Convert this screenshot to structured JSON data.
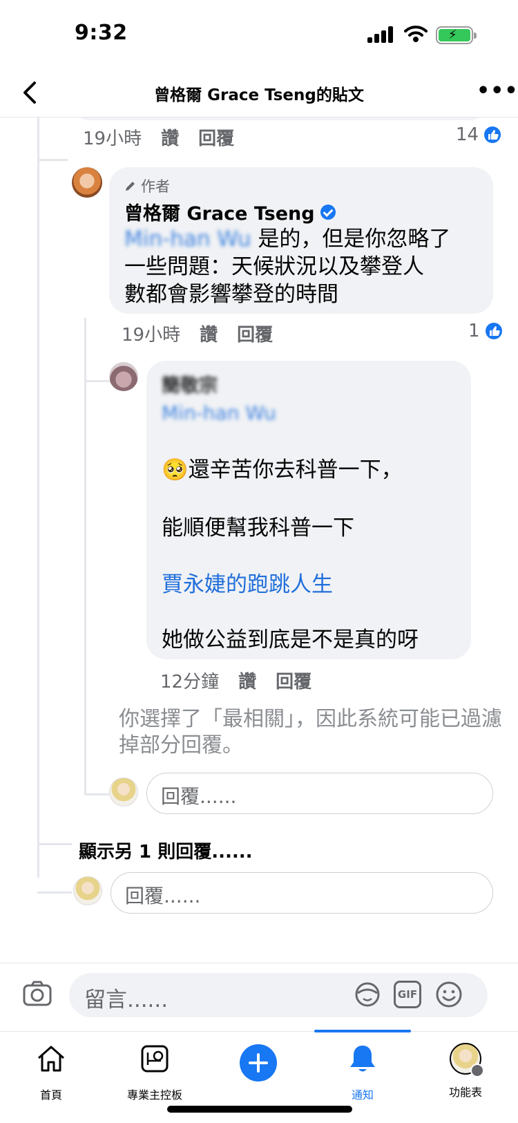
{
  "status": {
    "time": "9:32"
  },
  "header": {
    "title": "曾格爾 Grace Tseng的貼文"
  },
  "thread": {
    "top_comment_meta": {
      "time": "19小時",
      "like": "讚",
      "reply": "回覆",
      "reactions": "14"
    },
    "author_reply": {
      "tag": "作者",
      "name": "曾格爾 Grace Tseng",
      "mention": "Min-han Wu",
      "text_line1": "是的，但是你忽略了",
      "text_line2": "一些問題：天候狀況以及攀登人",
      "text_line3": "數都會影響攀登的時間",
      "time": "19小時",
      "like": "讚",
      "reply": "回覆",
      "reactions": "1"
    },
    "nested_reply": {
      "name": "簡敬宗",
      "mention": "Min-han Wu",
      "line1": "還辛苦你去科普一下，",
      "line2": "能順便幫我科普一下",
      "link": "賈永婕的跑跳人生",
      "line3": "她做公益到底是不是真的呀",
      "time": "12分鐘",
      "like": "讚",
      "reply": "回覆"
    },
    "filter_notice": "你選擇了「最相關」，因此系統可能已過濾掉部分回覆。",
    "nested_reply_placeholder": "回覆......",
    "show_more": "顯示另 1 則回覆......",
    "reply_placeholder": "回覆......"
  },
  "composer": {
    "placeholder": "留言......",
    "gif_label": "GIF"
  },
  "tabs": [
    {
      "label": "首頁",
      "icon": "home-icon"
    },
    {
      "label": "專業主控板",
      "icon": "dashboard-icon"
    },
    {
      "label": "",
      "icon": "create-plus-icon"
    },
    {
      "label": "通知",
      "icon": "bell-icon"
    },
    {
      "label": "功能表",
      "icon": "profile-menu-icon"
    }
  ],
  "colors": {
    "accent": "#1877f2",
    "bubble": "#f0f2f5",
    "secondary_text": "#65676b",
    "link": "#216fdb"
  }
}
